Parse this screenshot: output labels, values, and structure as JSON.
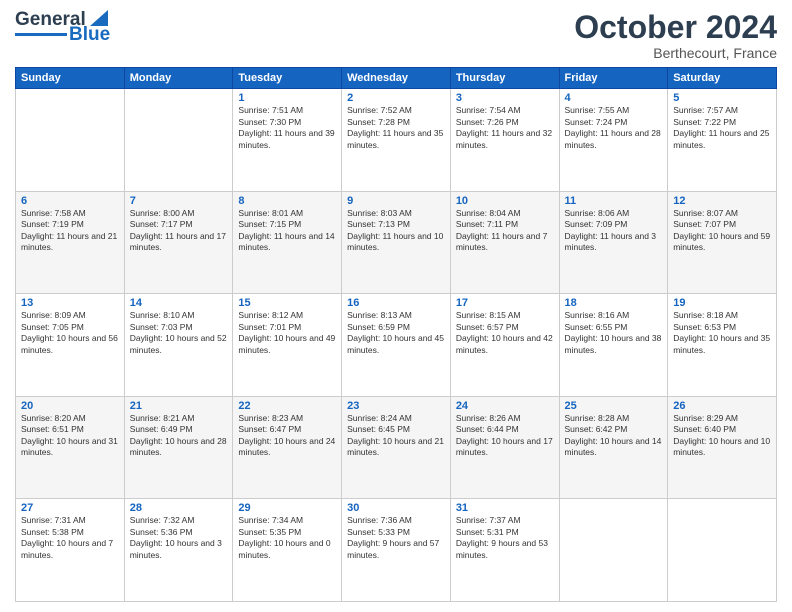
{
  "header": {
    "logo_general": "General",
    "logo_blue": "Blue",
    "month": "October 2024",
    "location": "Berthecourt, France"
  },
  "days_of_week": [
    "Sunday",
    "Monday",
    "Tuesday",
    "Wednesday",
    "Thursday",
    "Friday",
    "Saturday"
  ],
  "weeks": [
    [
      {
        "day": "",
        "info": ""
      },
      {
        "day": "",
        "info": ""
      },
      {
        "day": "1",
        "sunrise": "7:51 AM",
        "sunset": "7:30 PM",
        "daylight": "11 hours and 39 minutes."
      },
      {
        "day": "2",
        "sunrise": "7:52 AM",
        "sunset": "7:28 PM",
        "daylight": "11 hours and 35 minutes."
      },
      {
        "day": "3",
        "sunrise": "7:54 AM",
        "sunset": "7:26 PM",
        "daylight": "11 hours and 32 minutes."
      },
      {
        "day": "4",
        "sunrise": "7:55 AM",
        "sunset": "7:24 PM",
        "daylight": "11 hours and 28 minutes."
      },
      {
        "day": "5",
        "sunrise": "7:57 AM",
        "sunset": "7:22 PM",
        "daylight": "11 hours and 25 minutes."
      }
    ],
    [
      {
        "day": "6",
        "sunrise": "7:58 AM",
        "sunset": "7:19 PM",
        "daylight": "11 hours and 21 minutes."
      },
      {
        "day": "7",
        "sunrise": "8:00 AM",
        "sunset": "7:17 PM",
        "daylight": "11 hours and 17 minutes."
      },
      {
        "day": "8",
        "sunrise": "8:01 AM",
        "sunset": "7:15 PM",
        "daylight": "11 hours and 14 minutes."
      },
      {
        "day": "9",
        "sunrise": "8:03 AM",
        "sunset": "7:13 PM",
        "daylight": "11 hours and 10 minutes."
      },
      {
        "day": "10",
        "sunrise": "8:04 AM",
        "sunset": "7:11 PM",
        "daylight": "11 hours and 7 minutes."
      },
      {
        "day": "11",
        "sunrise": "8:06 AM",
        "sunset": "7:09 PM",
        "daylight": "11 hours and 3 minutes."
      },
      {
        "day": "12",
        "sunrise": "8:07 AM",
        "sunset": "7:07 PM",
        "daylight": "10 hours and 59 minutes."
      }
    ],
    [
      {
        "day": "13",
        "sunrise": "8:09 AM",
        "sunset": "7:05 PM",
        "daylight": "10 hours and 56 minutes."
      },
      {
        "day": "14",
        "sunrise": "8:10 AM",
        "sunset": "7:03 PM",
        "daylight": "10 hours and 52 minutes."
      },
      {
        "day": "15",
        "sunrise": "8:12 AM",
        "sunset": "7:01 PM",
        "daylight": "10 hours and 49 minutes."
      },
      {
        "day": "16",
        "sunrise": "8:13 AM",
        "sunset": "6:59 PM",
        "daylight": "10 hours and 45 minutes."
      },
      {
        "day": "17",
        "sunrise": "8:15 AM",
        "sunset": "6:57 PM",
        "daylight": "10 hours and 42 minutes."
      },
      {
        "day": "18",
        "sunrise": "8:16 AM",
        "sunset": "6:55 PM",
        "daylight": "10 hours and 38 minutes."
      },
      {
        "day": "19",
        "sunrise": "8:18 AM",
        "sunset": "6:53 PM",
        "daylight": "10 hours and 35 minutes."
      }
    ],
    [
      {
        "day": "20",
        "sunrise": "8:20 AM",
        "sunset": "6:51 PM",
        "daylight": "10 hours and 31 minutes."
      },
      {
        "day": "21",
        "sunrise": "8:21 AM",
        "sunset": "6:49 PM",
        "daylight": "10 hours and 28 minutes."
      },
      {
        "day": "22",
        "sunrise": "8:23 AM",
        "sunset": "6:47 PM",
        "daylight": "10 hours and 24 minutes."
      },
      {
        "day": "23",
        "sunrise": "8:24 AM",
        "sunset": "6:45 PM",
        "daylight": "10 hours and 21 minutes."
      },
      {
        "day": "24",
        "sunrise": "8:26 AM",
        "sunset": "6:44 PM",
        "daylight": "10 hours and 17 minutes."
      },
      {
        "day": "25",
        "sunrise": "8:28 AM",
        "sunset": "6:42 PM",
        "daylight": "10 hours and 14 minutes."
      },
      {
        "day": "26",
        "sunrise": "8:29 AM",
        "sunset": "6:40 PM",
        "daylight": "10 hours and 10 minutes."
      }
    ],
    [
      {
        "day": "27",
        "sunrise": "7:31 AM",
        "sunset": "5:38 PM",
        "daylight": "10 hours and 7 minutes."
      },
      {
        "day": "28",
        "sunrise": "7:32 AM",
        "sunset": "5:36 PM",
        "daylight": "10 hours and 3 minutes."
      },
      {
        "day": "29",
        "sunrise": "7:34 AM",
        "sunset": "5:35 PM",
        "daylight": "10 hours and 0 minutes."
      },
      {
        "day": "30",
        "sunrise": "7:36 AM",
        "sunset": "5:33 PM",
        "daylight": "9 hours and 57 minutes."
      },
      {
        "day": "31",
        "sunrise": "7:37 AM",
        "sunset": "5:31 PM",
        "daylight": "9 hours and 53 minutes."
      },
      {
        "day": "",
        "info": ""
      },
      {
        "day": "",
        "info": ""
      }
    ]
  ]
}
